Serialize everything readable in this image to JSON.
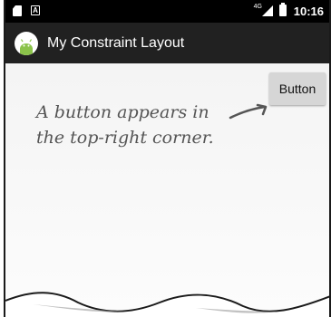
{
  "status_bar": {
    "network_label": "4G",
    "time": "10:16",
    "left_icons": [
      "sim-icon",
      "a-icon"
    ],
    "right_icons": [
      "signal-icon",
      "battery-icon"
    ],
    "a_icon_text": "A"
  },
  "app_bar": {
    "title": "My Constraint Layout",
    "icon": "android-icon",
    "background": "#212121"
  },
  "content": {
    "button_label": "Button",
    "annotation_line1": "A button appears in",
    "annotation_line2": "the top-right corner."
  },
  "colors": {
    "status_bar": "#000000",
    "content_background": "#f4f4f4",
    "button": "#d6d6d6",
    "android_green": "#8bc34a"
  }
}
